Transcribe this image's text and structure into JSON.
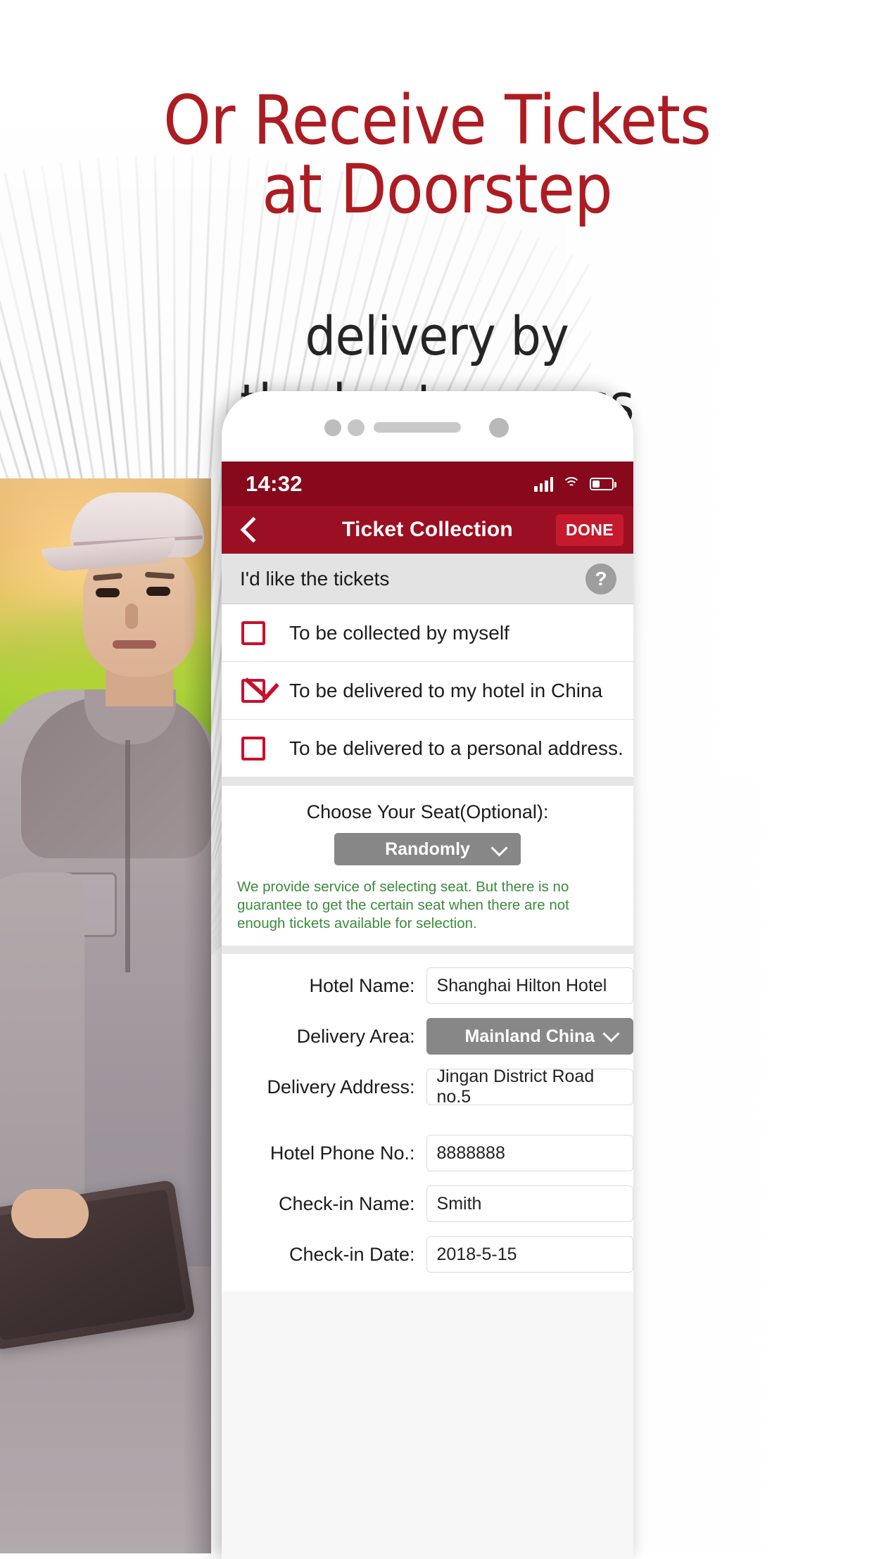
{
  "promo": {
    "headline_line1": "Or Receive Tickets",
    "headline_line2": "at Doorstep",
    "subline_line1": "delivery by",
    "subline_line2": "the best express",
    "headline_color": "#AD1C22",
    "subline_color": "#252525"
  },
  "phone": {
    "statusbar": {
      "time": "14:32",
      "signal_icon": "cellular-signal-icon",
      "wifi_icon": "wifi-icon",
      "battery_icon": "battery-low-icon",
      "bg_color": "#87091B"
    },
    "navbar": {
      "back_icon": "back-chevron-icon",
      "title": "Ticket Collection",
      "done_label": "DONE",
      "bg_color": "#9B0F22",
      "done_bg_color": "#C51A2E"
    },
    "section": {
      "label": "I'd like the tickets",
      "help_icon": "question-mark-icon",
      "help_glyph": "?"
    },
    "options": [
      {
        "label": "To be collected by myself",
        "checked": false
      },
      {
        "label": "To be delivered to my hotel in China",
        "checked": true
      },
      {
        "label": "To be delivered to a personal address.",
        "checked": false
      }
    ],
    "checkbox_color": "#C8102E",
    "seat": {
      "title": "Choose Your Seat(Optional):",
      "dropdown_value": "Randomly",
      "dropdown_icon": "chevron-down-icon",
      "note_line1": "We provide service of selecting seat. But there is no guarantee to get the",
      "note_line2": "certain seat when there are not enough tickets available for selection.",
      "note_color": "#3C8B3C",
      "dropdown_bg_color": "#878787"
    },
    "form": [
      {
        "label": "Hotel Name:",
        "value": "Shanghai Hilton Hotel",
        "type": "text",
        "wide": true
      },
      {
        "label": "Delivery Area:",
        "value": "Mainland China",
        "type": "select",
        "wide": false
      },
      {
        "label": "Delivery Address:",
        "value": "Jingan District Road no.5",
        "type": "text",
        "wide": true
      },
      {
        "label": "Hotel Phone No.:",
        "value": "8888888",
        "type": "text",
        "wide": false
      },
      {
        "label": "Check-in Name:",
        "value": "Smith",
        "type": "text",
        "wide": false
      },
      {
        "label": "Check-in Date:",
        "value": "2018-5-15",
        "type": "text",
        "wide": false
      }
    ]
  }
}
